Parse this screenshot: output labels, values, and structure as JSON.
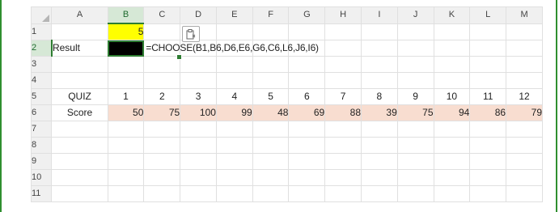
{
  "columns": [
    "A",
    "B",
    "C",
    "D",
    "E",
    "F",
    "G",
    "H",
    "I",
    "J",
    "K",
    "L",
    "M"
  ],
  "rows": [
    "1",
    "2",
    "3",
    "4",
    "5",
    "6",
    "7",
    "8",
    "9",
    "10",
    "11"
  ],
  "cells": {
    "B1": "5",
    "A2": "Result",
    "C2_formula": "=CHOOSE(B1,B6,D6,E6,G6,C6,L6,J6,I6)",
    "A5": "QUIZ",
    "A6": "Score"
  },
  "quiz_numbers": [
    "1",
    "2",
    "3",
    "4",
    "5",
    "6",
    "7",
    "8",
    "9",
    "10",
    "11",
    "12"
  ],
  "scores": [
    "50",
    "75",
    "100",
    "99",
    "48",
    "69",
    "88",
    "39",
    "75",
    "94",
    "86",
    "79"
  ],
  "paste_options_icon": "paste-options-icon",
  "colors": {
    "selection": "#2e7d32",
    "score_fill": "#f8ddd0",
    "input_fill": "#ffff00",
    "frame": "#2f8f2f"
  }
}
